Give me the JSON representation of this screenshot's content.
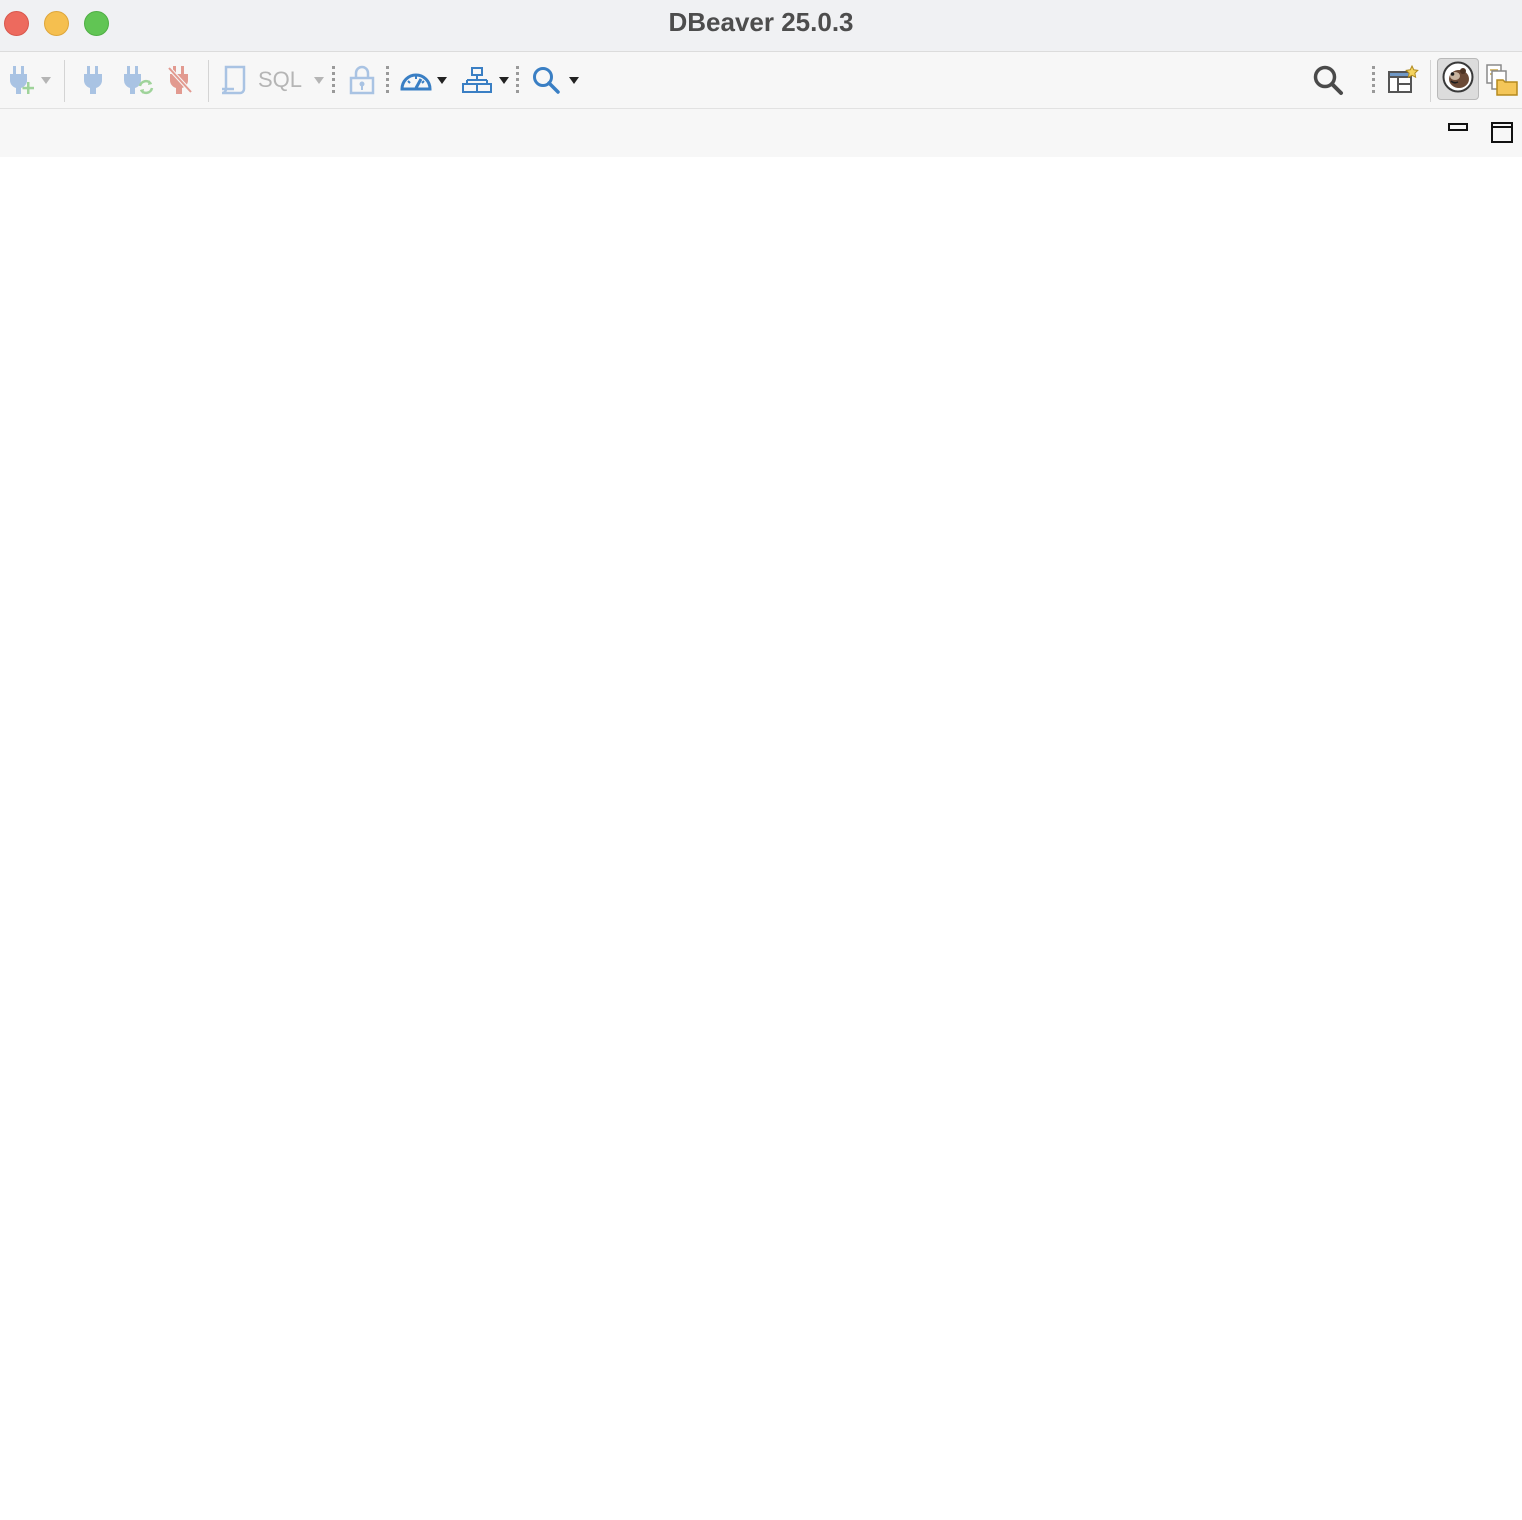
{
  "window": {
    "title": "DBeaver 25.0.3"
  },
  "toolbar": {
    "sql_label": "SQL"
  },
  "icons": {
    "new_connection": "plug-plus-icon",
    "connect": "plug-icon",
    "reconnect": "plug-refresh-icon",
    "disconnect": "plug-disconnect-icon",
    "sql_editor": "script-icon",
    "transaction_lock": "lock-icon",
    "dashboard": "gauge-icon",
    "schema": "diagram-icon",
    "search": "magnifier-icon",
    "global_search": "search-icon",
    "new_perspective": "open-perspective-icon",
    "dbeaver_perspective": "beaver-icon",
    "resources_perspective": "folder-files-icon",
    "minimize": "minimize-icon",
    "maximize": "maximize-icon"
  },
  "colors": {
    "accent_blue": "#3a7fc4",
    "disabled_blue": "#a9c3e3",
    "disconnect_red": "#e29a90"
  }
}
